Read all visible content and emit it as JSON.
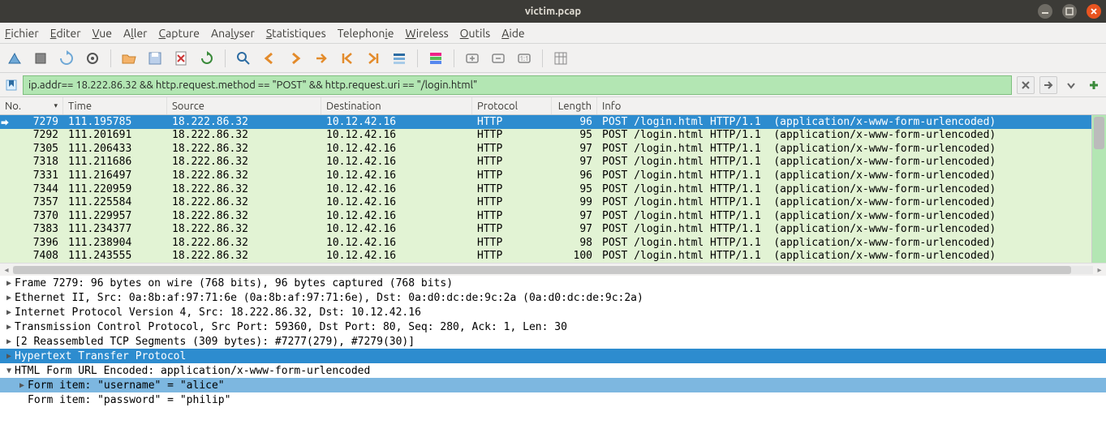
{
  "window": {
    "title": "victim.pcap"
  },
  "menu": {
    "items": [
      "Fichier",
      "Editer",
      "Vue",
      "Aller",
      "Capture",
      "Analyser",
      "Statistiques",
      "Telephonie",
      "Wireless",
      "Outils",
      "Aide"
    ],
    "underlinePos": [
      0,
      0,
      0,
      1,
      0,
      3,
      0,
      8,
      0,
      0,
      0
    ]
  },
  "filter": {
    "value": "ip.addr== 18.222.86.32 && http.request.method == \"POST\" && http.request.uri == \"/login.html\""
  },
  "columns": {
    "no": "No.",
    "time": "Time",
    "src": "Source",
    "dst": "Destination",
    "proto": "Protocol",
    "len": "Length",
    "info": "Info"
  },
  "packets": [
    {
      "no": "7279",
      "time": "111.195785",
      "src": "18.222.86.32",
      "dst": "10.12.42.16",
      "proto": "HTTP",
      "len": "96",
      "info": "POST /login.html HTTP/1.1  (application/x-www-form-urlencoded)",
      "sel": true
    },
    {
      "no": "7292",
      "time": "111.201691",
      "src": "18.222.86.32",
      "dst": "10.12.42.16",
      "proto": "HTTP",
      "len": "95",
      "info": "POST /login.html HTTP/1.1  (application/x-www-form-urlencoded)"
    },
    {
      "no": "7305",
      "time": "111.206433",
      "src": "18.222.86.32",
      "dst": "10.12.42.16",
      "proto": "HTTP",
      "len": "97",
      "info": "POST /login.html HTTP/1.1  (application/x-www-form-urlencoded)"
    },
    {
      "no": "7318",
      "time": "111.211686",
      "src": "18.222.86.32",
      "dst": "10.12.42.16",
      "proto": "HTTP",
      "len": "97",
      "info": "POST /login.html HTTP/1.1  (application/x-www-form-urlencoded)"
    },
    {
      "no": "7331",
      "time": "111.216497",
      "src": "18.222.86.32",
      "dst": "10.12.42.16",
      "proto": "HTTP",
      "len": "96",
      "info": "POST /login.html HTTP/1.1  (application/x-www-form-urlencoded)"
    },
    {
      "no": "7344",
      "time": "111.220959",
      "src": "18.222.86.32",
      "dst": "10.12.42.16",
      "proto": "HTTP",
      "len": "95",
      "info": "POST /login.html HTTP/1.1  (application/x-www-form-urlencoded)"
    },
    {
      "no": "7357",
      "time": "111.225584",
      "src": "18.222.86.32",
      "dst": "10.12.42.16",
      "proto": "HTTP",
      "len": "99",
      "info": "POST /login.html HTTP/1.1  (application/x-www-form-urlencoded)"
    },
    {
      "no": "7370",
      "time": "111.229957",
      "src": "18.222.86.32",
      "dst": "10.12.42.16",
      "proto": "HTTP",
      "len": "97",
      "info": "POST /login.html HTTP/1.1  (application/x-www-form-urlencoded)"
    },
    {
      "no": "7383",
      "time": "111.234377",
      "src": "18.222.86.32",
      "dst": "10.12.42.16",
      "proto": "HTTP",
      "len": "97",
      "info": "POST /login.html HTTP/1.1  (application/x-www-form-urlencoded)"
    },
    {
      "no": "7396",
      "time": "111.238904",
      "src": "18.222.86.32",
      "dst": "10.12.42.16",
      "proto": "HTTP",
      "len": "98",
      "info": "POST /login.html HTTP/1.1  (application/x-www-form-urlencoded)"
    },
    {
      "no": "7408",
      "time": "111.243555",
      "src": "18.222.86.32",
      "dst": "10.12.42.16",
      "proto": "HTTP",
      "len": "100",
      "info": "POST /login.html HTTP/1.1  (application/x-www-form-urlencoded)"
    }
  ],
  "details": [
    {
      "tri": "▶",
      "text": "Frame 7279: 96 bytes on wire (768 bits), 96 bytes captured (768 bits)"
    },
    {
      "tri": "▶",
      "text": "Ethernet II, Src: 0a:8b:af:97:71:6e (0a:8b:af:97:71:6e), Dst: 0a:d0:dc:de:9c:2a (0a:d0:dc:de:9c:2a)"
    },
    {
      "tri": "▶",
      "text": "Internet Protocol Version 4, Src: 18.222.86.32, Dst: 10.12.42.16"
    },
    {
      "tri": "▶",
      "text": "Transmission Control Protocol, Src Port: 59360, Dst Port: 80, Seq: 280, Ack: 1, Len: 30"
    },
    {
      "tri": "▶",
      "text": "[2 Reassembled TCP Segments (309 bytes): #7277(279), #7279(30)]"
    },
    {
      "tri": "▶",
      "text": "Hypertext Transfer Protocol",
      "hl": "hl1"
    },
    {
      "tri": "▼",
      "text": "HTML Form URL Encoded: application/x-www-form-urlencoded",
      "open": true
    },
    {
      "tri": "▶",
      "text": "Form item: \"username\" = \"alice\"",
      "indent": 1,
      "hl": "hl2"
    },
    {
      "tri": " ",
      "text": "Form item: \"password\" = \"philip\"",
      "indent": 1
    }
  ]
}
